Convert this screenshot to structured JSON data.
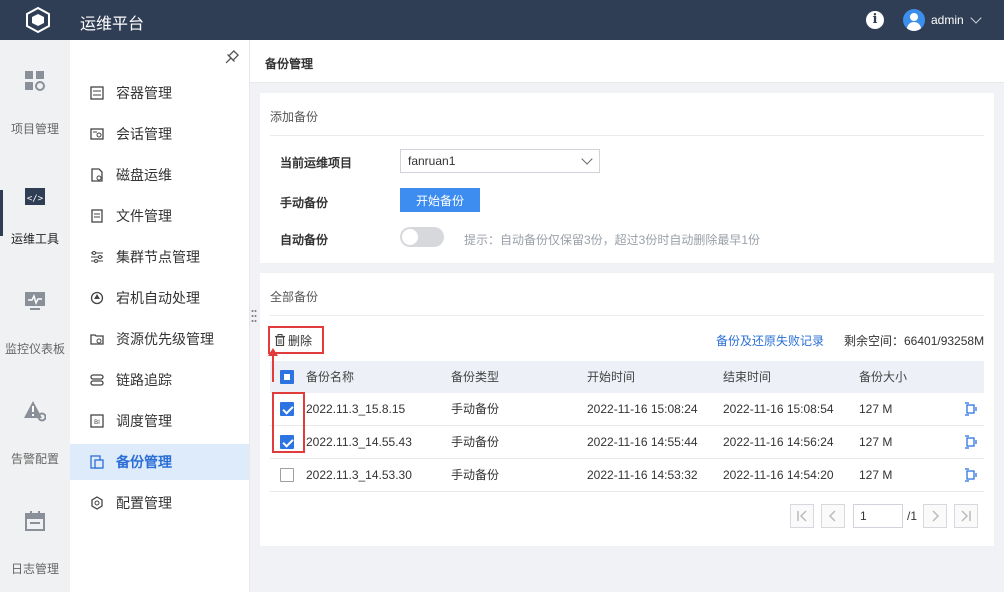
{
  "header": {
    "app_title": "运维平台",
    "info_icon": "info-icon",
    "username": "admin"
  },
  "rail": [
    {
      "label": "项目管理",
      "icon": "grid-icon"
    },
    {
      "label": "运维工具",
      "icon": "code-window-icon",
      "active": true
    },
    {
      "label": "监控仪表板",
      "icon": "monitor-icon"
    },
    {
      "label": "告警配置",
      "icon": "warning-gear-icon"
    },
    {
      "label": "日志管理",
      "icon": "calendar-icon"
    }
  ],
  "menu": [
    {
      "label": "容器管理",
      "icon": "container-icon"
    },
    {
      "label": "会话管理",
      "icon": "session-icon"
    },
    {
      "label": "磁盘运维",
      "icon": "disk-icon"
    },
    {
      "label": "文件管理",
      "icon": "file-icon"
    },
    {
      "label": "集群节点管理",
      "icon": "sliders-icon"
    },
    {
      "label": "宕机自动处理",
      "icon": "auto-recover-icon"
    },
    {
      "label": "资源优先级管理",
      "icon": "priority-icon"
    },
    {
      "label": "链路追踪",
      "icon": "trace-icon"
    },
    {
      "label": "调度管理",
      "icon": "schedule-icon"
    },
    {
      "label": "备份管理",
      "icon": "backup-icon",
      "active": true
    },
    {
      "label": "配置管理",
      "icon": "config-gear-icon"
    }
  ],
  "page": {
    "title": "备份管理"
  },
  "add_backup": {
    "title": "添加备份",
    "current_project_label": "当前运维项目",
    "current_project_value": "fanruan1",
    "manual_label": "手动备份",
    "manual_button": "开始备份",
    "auto_label": "自动备份",
    "auto_enabled": false,
    "hint": "提示：自动备份仅保留3份，超过3份时自动删除最早1份"
  },
  "all_backups": {
    "title": "全部备份",
    "delete_label": "删除",
    "fail_link": "备份及还原失败记录",
    "space": "剩余空间：66401/93258M",
    "columns": [
      "备份名称",
      "备份类型",
      "开始时间",
      "结束时间",
      "备份大小"
    ],
    "rows": [
      {
        "name": "2022.11.3_15.8.15",
        "type": "手动备份",
        "start": "2022-11-16 15:08:24",
        "end": "2022-11-16 15:08:54",
        "size": "127 M",
        "checked": true
      },
      {
        "name": "2022.11.3_14.55.43",
        "type": "手动备份",
        "start": "2022-11-16 14:55:44",
        "end": "2022-11-16 14:56:24",
        "size": "127 M",
        "checked": true
      },
      {
        "name": "2022.11.3_14.53.30",
        "type": "手动备份",
        "start": "2022-11-16 14:53:32",
        "end": "2022-11-16 14:54:20",
        "size": "127 M",
        "checked": false
      }
    ]
  },
  "pager": {
    "current": "1",
    "total": "/1"
  },
  "colors": {
    "header_bg": "#2f3e55",
    "primary": "#3d8cf0",
    "link": "#2b6fd6",
    "highlight_red": "#e23b3b",
    "menu_active_bg": "#deebfa"
  }
}
